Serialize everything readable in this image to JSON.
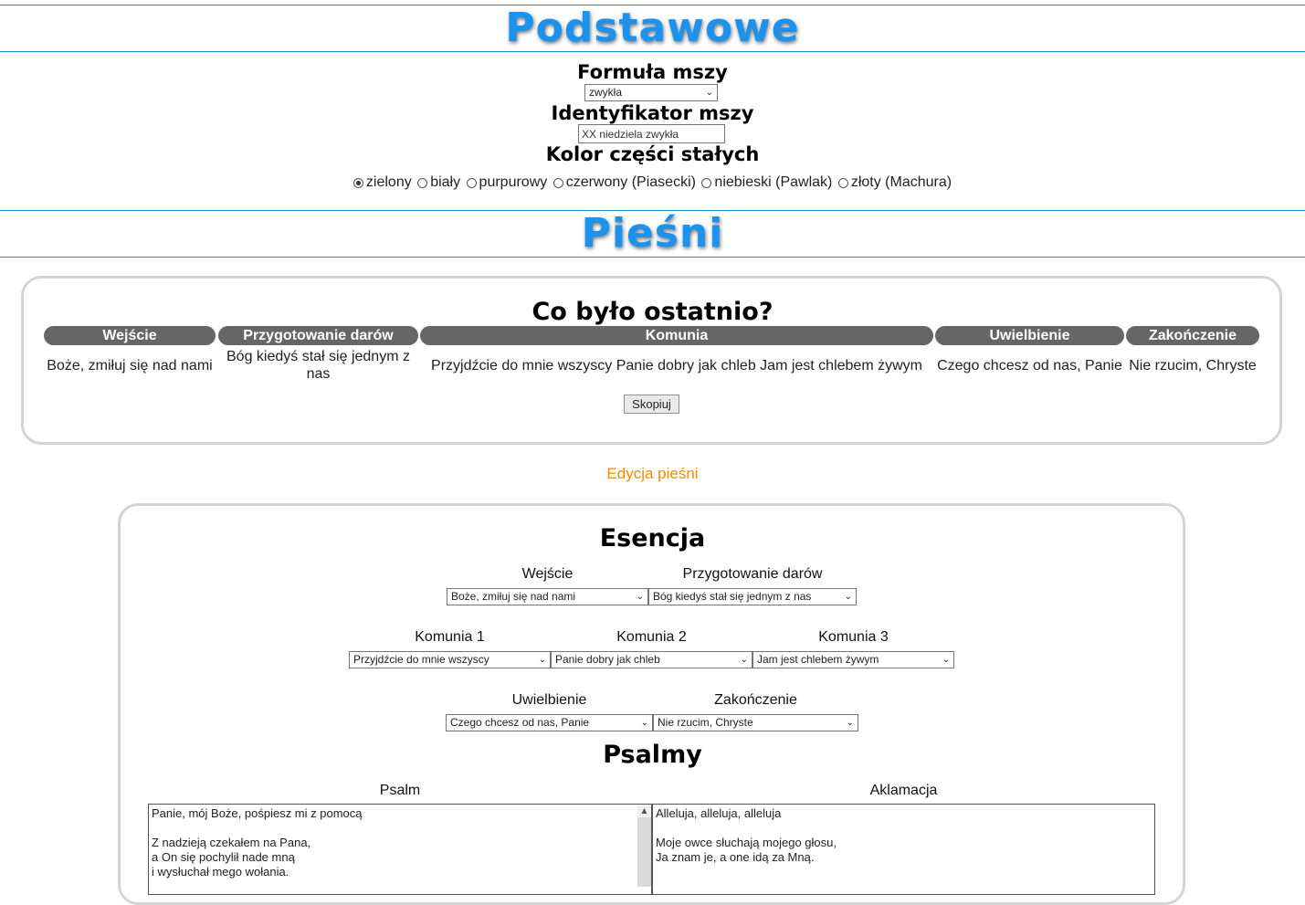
{
  "sections": {
    "basic_title": "Podstawowe",
    "songs_title": "Pieśni"
  },
  "basic": {
    "formula_label": "Formuła mszy",
    "formula_value": "zwykła",
    "id_label": "Identyfikator mszy",
    "id_value": "XX niedziela zwykła",
    "color_label": "Kolor części stałych",
    "color_options": [
      "zielony",
      "biały",
      "purpurowy",
      "czerwony (Piasecki)",
      "niebieski (Pawlak)",
      "złoty (Machura)"
    ],
    "color_selected": "zielony"
  },
  "recent": {
    "title": "Co było ostatnio?",
    "headers": [
      "Wejście",
      "Przygotowanie darów",
      "Komunia",
      "Uwielbienie",
      "Zakończenie"
    ],
    "values": [
      "Boże, zmiłuj się nad nami",
      "Bóg kiedyś stał się jednym z nas",
      "Przyjdźcie do mnie wszyscy Panie dobry jak chleb Jam jest chlebem żywym",
      "Czego chcesz od nas, Panie",
      "Nie rzucim, Chryste"
    ],
    "copy_button": "Skopiuj"
  },
  "edit_link": "Edycja pieśni",
  "essence": {
    "title": "Esencja",
    "entrance_label": "Wejście",
    "entrance_value": "Boże, zmiłuj się nad nami",
    "offertory_label": "Przygotowanie darów",
    "offertory_value": "Bóg kiedyś stał się jednym z nas",
    "communion1_label": "Komunia 1",
    "communion1_value": "Przyjdźcie do mnie wszyscy",
    "communion2_label": "Komunia 2",
    "communion2_value": "Panie dobry jak chleb",
    "communion3_label": "Komunia 3",
    "communion3_value": "Jam jest chlebem żywym",
    "adoration_label": "Uwielbienie",
    "adoration_value": "Czego chcesz od nas, Panie",
    "closing_label": "Zakończenie",
    "closing_value": "Nie rzucim, Chryste"
  },
  "psalms": {
    "title": "Psalmy",
    "psalm_label": "Psalm",
    "psalm_text": "Panie, mój Boże, pośpiesz mi z pomocą\n\nZ nadzieją czekałem na Pana,\na On się pochylił nade mną\ni wysłuchał mego wołania.",
    "acclamation_label": "Aklamacja",
    "acclamation_text": "Alleluja, alleluja, alleluja\n\nMoje owce słuchają mojego głosu,\nJa znam je, a one idą za Mną."
  }
}
